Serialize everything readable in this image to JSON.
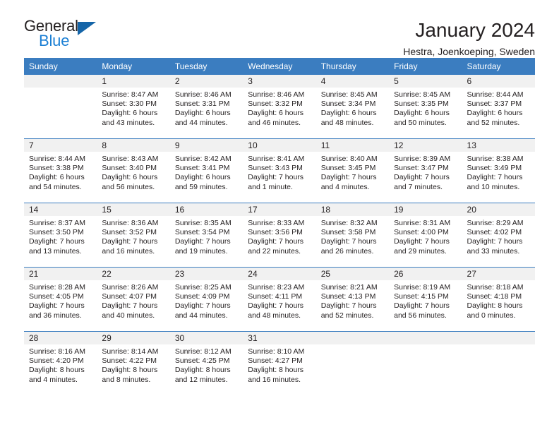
{
  "brand": {
    "word_one": "General",
    "word_two": "Blue",
    "triangle_icon": "triangle-icon"
  },
  "header": {
    "title": "January 2024",
    "location": "Hestra, Joenkoeping, Sweden"
  },
  "colors": {
    "header_blue": "#3b7dc0",
    "brand_blue": "#1b7fd4",
    "daynum_band": "#f1f1f1",
    "text": "#231f20"
  },
  "weekdays": [
    "Sunday",
    "Monday",
    "Tuesday",
    "Wednesday",
    "Thursday",
    "Friday",
    "Saturday"
  ],
  "weeks": [
    [
      {
        "day": "",
        "lines": []
      },
      {
        "day": "1",
        "lines": [
          "Sunrise: 8:47 AM",
          "Sunset: 3:30 PM",
          "Daylight: 6 hours",
          "and 43 minutes."
        ]
      },
      {
        "day": "2",
        "lines": [
          "Sunrise: 8:46 AM",
          "Sunset: 3:31 PM",
          "Daylight: 6 hours",
          "and 44 minutes."
        ]
      },
      {
        "day": "3",
        "lines": [
          "Sunrise: 8:46 AM",
          "Sunset: 3:32 PM",
          "Daylight: 6 hours",
          "and 46 minutes."
        ]
      },
      {
        "day": "4",
        "lines": [
          "Sunrise: 8:45 AM",
          "Sunset: 3:34 PM",
          "Daylight: 6 hours",
          "and 48 minutes."
        ]
      },
      {
        "day": "5",
        "lines": [
          "Sunrise: 8:45 AM",
          "Sunset: 3:35 PM",
          "Daylight: 6 hours",
          "and 50 minutes."
        ]
      },
      {
        "day": "6",
        "lines": [
          "Sunrise: 8:44 AM",
          "Sunset: 3:37 PM",
          "Daylight: 6 hours",
          "and 52 minutes."
        ]
      }
    ],
    [
      {
        "day": "7",
        "lines": [
          "Sunrise: 8:44 AM",
          "Sunset: 3:38 PM",
          "Daylight: 6 hours",
          "and 54 minutes."
        ]
      },
      {
        "day": "8",
        "lines": [
          "Sunrise: 8:43 AM",
          "Sunset: 3:40 PM",
          "Daylight: 6 hours",
          "and 56 minutes."
        ]
      },
      {
        "day": "9",
        "lines": [
          "Sunrise: 8:42 AM",
          "Sunset: 3:41 PM",
          "Daylight: 6 hours",
          "and 59 minutes."
        ]
      },
      {
        "day": "10",
        "lines": [
          "Sunrise: 8:41 AM",
          "Sunset: 3:43 PM",
          "Daylight: 7 hours",
          "and 1 minute."
        ]
      },
      {
        "day": "11",
        "lines": [
          "Sunrise: 8:40 AM",
          "Sunset: 3:45 PM",
          "Daylight: 7 hours",
          "and 4 minutes."
        ]
      },
      {
        "day": "12",
        "lines": [
          "Sunrise: 8:39 AM",
          "Sunset: 3:47 PM",
          "Daylight: 7 hours",
          "and 7 minutes."
        ]
      },
      {
        "day": "13",
        "lines": [
          "Sunrise: 8:38 AM",
          "Sunset: 3:49 PM",
          "Daylight: 7 hours",
          "and 10 minutes."
        ]
      }
    ],
    [
      {
        "day": "14",
        "lines": [
          "Sunrise: 8:37 AM",
          "Sunset: 3:50 PM",
          "Daylight: 7 hours",
          "and 13 minutes."
        ]
      },
      {
        "day": "15",
        "lines": [
          "Sunrise: 8:36 AM",
          "Sunset: 3:52 PM",
          "Daylight: 7 hours",
          "and 16 minutes."
        ]
      },
      {
        "day": "16",
        "lines": [
          "Sunrise: 8:35 AM",
          "Sunset: 3:54 PM",
          "Daylight: 7 hours",
          "and 19 minutes."
        ]
      },
      {
        "day": "17",
        "lines": [
          "Sunrise: 8:33 AM",
          "Sunset: 3:56 PM",
          "Daylight: 7 hours",
          "and 22 minutes."
        ]
      },
      {
        "day": "18",
        "lines": [
          "Sunrise: 8:32 AM",
          "Sunset: 3:58 PM",
          "Daylight: 7 hours",
          "and 26 minutes."
        ]
      },
      {
        "day": "19",
        "lines": [
          "Sunrise: 8:31 AM",
          "Sunset: 4:00 PM",
          "Daylight: 7 hours",
          "and 29 minutes."
        ]
      },
      {
        "day": "20",
        "lines": [
          "Sunrise: 8:29 AM",
          "Sunset: 4:02 PM",
          "Daylight: 7 hours",
          "and 33 minutes."
        ]
      }
    ],
    [
      {
        "day": "21",
        "lines": [
          "Sunrise: 8:28 AM",
          "Sunset: 4:05 PM",
          "Daylight: 7 hours",
          "and 36 minutes."
        ]
      },
      {
        "day": "22",
        "lines": [
          "Sunrise: 8:26 AM",
          "Sunset: 4:07 PM",
          "Daylight: 7 hours",
          "and 40 minutes."
        ]
      },
      {
        "day": "23",
        "lines": [
          "Sunrise: 8:25 AM",
          "Sunset: 4:09 PM",
          "Daylight: 7 hours",
          "and 44 minutes."
        ]
      },
      {
        "day": "24",
        "lines": [
          "Sunrise: 8:23 AM",
          "Sunset: 4:11 PM",
          "Daylight: 7 hours",
          "and 48 minutes."
        ]
      },
      {
        "day": "25",
        "lines": [
          "Sunrise: 8:21 AM",
          "Sunset: 4:13 PM",
          "Daylight: 7 hours",
          "and 52 minutes."
        ]
      },
      {
        "day": "26",
        "lines": [
          "Sunrise: 8:19 AM",
          "Sunset: 4:15 PM",
          "Daylight: 7 hours",
          "and 56 minutes."
        ]
      },
      {
        "day": "27",
        "lines": [
          "Sunrise: 8:18 AM",
          "Sunset: 4:18 PM",
          "Daylight: 8 hours",
          "and 0 minutes."
        ]
      }
    ],
    [
      {
        "day": "28",
        "lines": [
          "Sunrise: 8:16 AM",
          "Sunset: 4:20 PM",
          "Daylight: 8 hours",
          "and 4 minutes."
        ]
      },
      {
        "day": "29",
        "lines": [
          "Sunrise: 8:14 AM",
          "Sunset: 4:22 PM",
          "Daylight: 8 hours",
          "and 8 minutes."
        ]
      },
      {
        "day": "30",
        "lines": [
          "Sunrise: 8:12 AM",
          "Sunset: 4:25 PM",
          "Daylight: 8 hours",
          "and 12 minutes."
        ]
      },
      {
        "day": "31",
        "lines": [
          "Sunrise: 8:10 AM",
          "Sunset: 4:27 PM",
          "Daylight: 8 hours",
          "and 16 minutes."
        ]
      },
      {
        "day": "",
        "lines": []
      },
      {
        "day": "",
        "lines": []
      },
      {
        "day": "",
        "lines": []
      }
    ]
  ]
}
